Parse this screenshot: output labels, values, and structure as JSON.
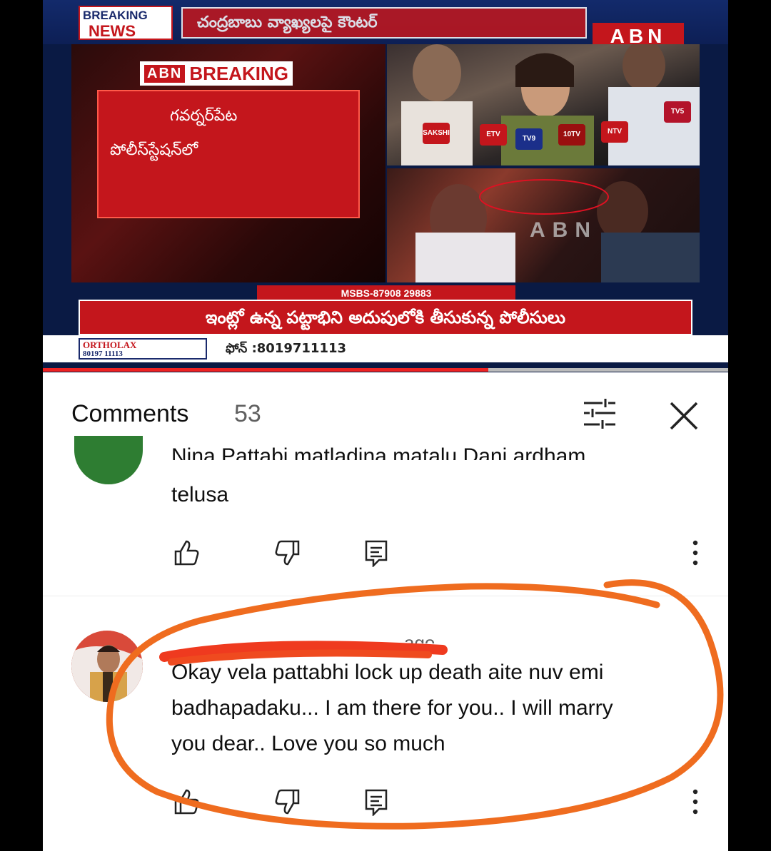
{
  "video": {
    "breaking_news_line1": "BREAKING",
    "breaking_news_line2": "NEWS",
    "top_marquee": "చంద్రబాబు వ్యాఖ్యలపై కౌంటర్",
    "abn_logo": "ABN",
    "abn_breaking_logo": "ABN",
    "abn_breaking_word": "BREAKING",
    "studio_card_line1": "గవర్నర్‌పేట",
    "studio_card_line2": "పోలీస్‌స్టేషన్‌లో",
    "mic_labels": [
      "SAKSHI",
      "ETV",
      "TV9",
      "TV5",
      "NTV",
      "10TV"
    ],
    "watermark": "ABN",
    "ticker_label": "MSBS-87908 29883",
    "ticker_text": "ఇంట్లో ఉన్న పట్టాభిని అదుపులోకి తీసుకున్న పోలీసులు",
    "sponsor_logo_line1": "ORTHOLAX",
    "sponsor_logo_line2": "80197 11113",
    "sponsor_phone": "ఫోన్ :8019711113",
    "progress_fraction": 0.65
  },
  "comments": {
    "title": "Comments",
    "count": "53",
    "items": [
      {
        "partial_text_cut": "Nina Pattabi matladina matalu Dani ardham",
        "text": "telusa"
      },
      {
        "meta_cut": "ago",
        "text_line1": "Okay vela pattabhi lock up death aite nuv emi",
        "text_line2": "badhapadaku...  I am there for you..  I will marry",
        "text_line3": "you dear..  Love you so much"
      }
    ]
  },
  "colors": {
    "abn_red": "#c4161c",
    "abn_blue": "#132a6b",
    "annotation_orange": "#ef6c1f",
    "progress_red": "#e22222"
  },
  "icons": [
    "filter-icon",
    "close-icon",
    "like-icon",
    "dislike-icon",
    "reply-icon",
    "more-vert-icon"
  ]
}
